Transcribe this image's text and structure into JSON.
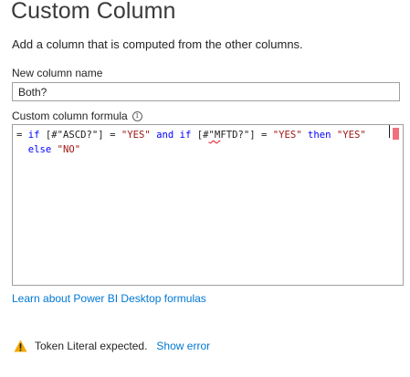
{
  "dialog": {
    "title": "Custom Column",
    "subtitle": "Add a column that is computed from the other columns."
  },
  "name_field": {
    "label": "New column name",
    "value": "Both?"
  },
  "formula_field": {
    "label": "Custom column formula",
    "info_icon": "info-icon",
    "tokens": {
      "t1": "= ",
      "t2": "if",
      "t3": " [#\"ASCD?\"] = ",
      "t4": "\"YES\"",
      "t5": " ",
      "t6": "and",
      "t7": " ",
      "t8": "if",
      "t9": " [#",
      "t10": "\"M",
      "t11": "FTD?\"] = ",
      "t12": "\"YES\"",
      "t13": " ",
      "t14": "then",
      "t15": " ",
      "t16": "\"YES\"",
      "t17": "\n  ",
      "t18": "else",
      "t19": " ",
      "t20": "\"NO\""
    }
  },
  "learn_link": "Learn about Power BI Desktop formulas",
  "status": {
    "icon": "warning-icon",
    "message": "Token Literal expected.",
    "action": "Show error"
  },
  "colors": {
    "keyword": "#0000ff",
    "string": "#a31515",
    "link": "#0078d4",
    "error_marker": "#f1707b",
    "warning": "#f2a900"
  }
}
